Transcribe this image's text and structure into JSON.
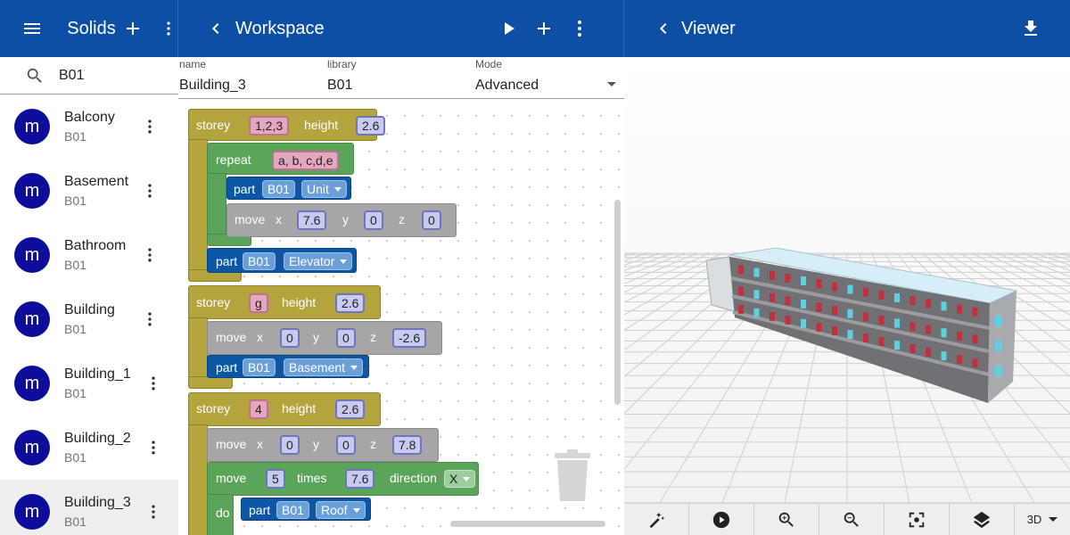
{
  "left_bar": {
    "title": "Solids"
  },
  "search": {
    "value": "B01"
  },
  "solids": [
    {
      "avatar": "m",
      "name": "Balcony",
      "library": "B01"
    },
    {
      "avatar": "m",
      "name": "Basement",
      "library": "B01"
    },
    {
      "avatar": "m",
      "name": "Bathroom",
      "library": "B01"
    },
    {
      "avatar": "m",
      "name": "Building",
      "library": "B01"
    },
    {
      "avatar": "m",
      "name": "Building_1",
      "library": "B01"
    },
    {
      "avatar": "m",
      "name": "Building_2",
      "library": "B01"
    },
    {
      "avatar": "m",
      "name": "Building_3",
      "library": "B01",
      "selected": true
    }
  ],
  "workspace_bar": {
    "title": "Workspace"
  },
  "workspace_fields": {
    "name_label": "name",
    "name_value": "Building_3",
    "library_label": "library",
    "library_value": "B01",
    "mode_label": "Mode",
    "mode_value": "Advanced"
  },
  "blocks": {
    "storey": "storey",
    "height": "height",
    "repeat": "repeat",
    "part": "part",
    "move": "move",
    "x": "x",
    "y": "y",
    "z": "z",
    "times": "times",
    "direction": "direction",
    "do": "do",
    "s1_floors": "1,2,3",
    "s1_height": "2.6",
    "repeat_list": "a, b, c,d,e",
    "p1_lib": "B01",
    "p1_part": "Unit",
    "m1_x": "7.6",
    "m1_y": "0",
    "m1_z": "0",
    "p2_lib": "B01",
    "p2_part": "Elevator",
    "s2_floors": "g",
    "s2_height": "2.6",
    "m2_x": "0",
    "m2_y": "0",
    "m2_z": "-2.6",
    "p3_lib": "B01",
    "p3_part": "Basement",
    "s3_floors": "4",
    "s3_height": "2.6",
    "m3_x": "0",
    "m3_y": "0",
    "m3_z": "7.8",
    "r_times": "5",
    "r_dist": "7.6",
    "r_dir": "X",
    "p4_lib": "B01",
    "p4_part": "Roof"
  },
  "viewer_bar": {
    "title": "Viewer"
  },
  "viewer_toolbar": {
    "view_mode": "3D"
  },
  "icons": [
    "menu-icon",
    "add-icon",
    "more-vert-icon",
    "search-icon",
    "back-icon",
    "play-icon",
    "download-icon",
    "magic-wand-icon",
    "play-circle-icon",
    "zoom-in-icon",
    "zoom-out-icon",
    "fit-icon",
    "layers-icon",
    "trash-icon"
  ],
  "colors": {
    "appbar": "#0d4fa5",
    "avatar": "#0d0d9b",
    "storey_block": "#b3a43d",
    "repeat_block": "#5ba55b",
    "part_block": "#0b56a5",
    "move_block": "#a6a6a6"
  }
}
